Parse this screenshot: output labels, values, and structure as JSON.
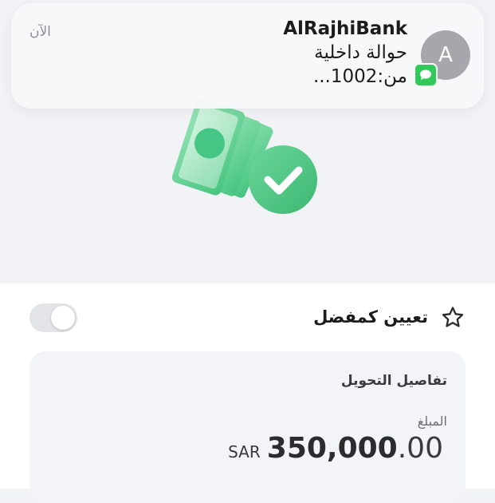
{
  "notification": {
    "sender": "AlRajhiBank",
    "line1": "حوالة داخلية",
    "line2": "من:1002...",
    "time": "الآن",
    "avatar_initial": "A",
    "app_icon": "messages-icon",
    "badge_color": "#32c95a"
  },
  "hero": {
    "icon": "money-transfer-success-icon",
    "accent": "#3fc47f"
  },
  "favorite": {
    "label": "تعيين كمفضل",
    "icon": "star-icon",
    "toggle_on": false
  },
  "transfer_details": {
    "title": "تفاصيل التحويل",
    "amount_label": "المبلغ",
    "currency": "SAR",
    "amount_main": "350,000",
    "amount_decimal": ".00"
  }
}
